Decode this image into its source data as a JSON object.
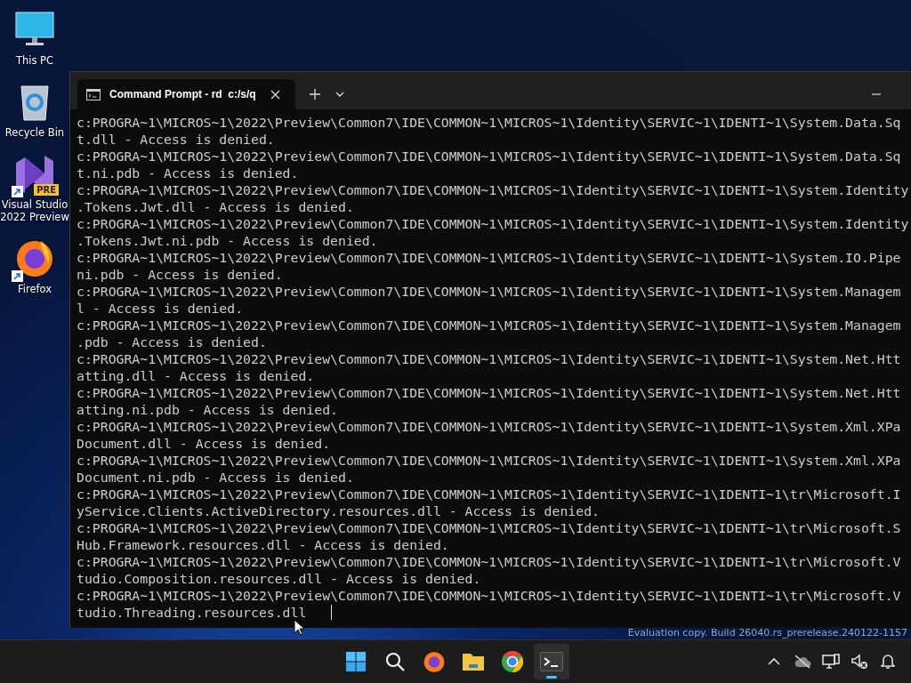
{
  "desktop_icons": [
    {
      "label": "This PC",
      "kind": "pc",
      "shortcut": false
    },
    {
      "label": "Recycle Bin",
      "kind": "bin",
      "shortcut": false
    },
    {
      "label": "Visual Studio 2022 Preview",
      "kind": "vs",
      "badge": "PRE",
      "shortcut": true
    },
    {
      "label": "Firefox",
      "kind": "firefox",
      "shortcut": true
    }
  ],
  "window": {
    "tabs": [
      {
        "title": "Command Prompt - rd  c:/s/q",
        "selected": true
      }
    ],
    "lines": [
      "c:PROGRA~1\\MICROS~1\\2022\\Preview\\Common7\\IDE\\COMMON~1\\MICROS~1\\Identity\\SERVIC~1\\IDENTI~1\\System.Data.Sq",
      "t.dll - Access is denied.",
      "c:PROGRA~1\\MICROS~1\\2022\\Preview\\Common7\\IDE\\COMMON~1\\MICROS~1\\Identity\\SERVIC~1\\IDENTI~1\\System.Data.Sq",
      "t.ni.pdb - Access is denied.",
      "c:PROGRA~1\\MICROS~1\\2022\\Preview\\Common7\\IDE\\COMMON~1\\MICROS~1\\Identity\\SERVIC~1\\IDENTI~1\\System.Identity",
      ".Tokens.Jwt.dll - Access is denied.",
      "c:PROGRA~1\\MICROS~1\\2022\\Preview\\Common7\\IDE\\COMMON~1\\MICROS~1\\Identity\\SERVIC~1\\IDENTI~1\\System.Identity",
      ".Tokens.Jwt.ni.pdb - Access is denied.",
      "c:PROGRA~1\\MICROS~1\\2022\\Preview\\Common7\\IDE\\COMMON~1\\MICROS~1\\Identity\\SERVIC~1\\IDENTI~1\\System.IO.Pipe",
      "ni.pdb - Access is denied.",
      "c:PROGRA~1\\MICROS~1\\2022\\Preview\\Common7\\IDE\\COMMON~1\\MICROS~1\\Identity\\SERVIC~1\\IDENTI~1\\System.Managem",
      "l - Access is denied.",
      "c:PROGRA~1\\MICROS~1\\2022\\Preview\\Common7\\IDE\\COMMON~1\\MICROS~1\\Identity\\SERVIC~1\\IDENTI~1\\System.Managem",
      ".pdb - Access is denied.",
      "c:PROGRA~1\\MICROS~1\\2022\\Preview\\Common7\\IDE\\COMMON~1\\MICROS~1\\Identity\\SERVIC~1\\IDENTI~1\\System.Net.Htt",
      "atting.dll - Access is denied.",
      "c:PROGRA~1\\MICROS~1\\2022\\Preview\\Common7\\IDE\\COMMON~1\\MICROS~1\\Identity\\SERVIC~1\\IDENTI~1\\System.Net.Htt",
      "atting.ni.pdb - Access is denied.",
      "c:PROGRA~1\\MICROS~1\\2022\\Preview\\Common7\\IDE\\COMMON~1\\MICROS~1\\Identity\\SERVIC~1\\IDENTI~1\\System.Xml.XPa",
      "Document.dll - Access is denied.",
      "c:PROGRA~1\\MICROS~1\\2022\\Preview\\Common7\\IDE\\COMMON~1\\MICROS~1\\Identity\\SERVIC~1\\IDENTI~1\\System.Xml.XPa",
      "Document.ni.pdb - Access is denied.",
      "c:PROGRA~1\\MICROS~1\\2022\\Preview\\Common7\\IDE\\COMMON~1\\MICROS~1\\Identity\\SERVIC~1\\IDENTI~1\\tr\\Microsoft.I",
      "yService.Clients.ActiveDirectory.resources.dll - Access is denied.",
      "c:PROGRA~1\\MICROS~1\\2022\\Preview\\Common7\\IDE\\COMMON~1\\MICROS~1\\Identity\\SERVIC~1\\IDENTI~1\\tr\\Microsoft.S",
      "Hub.Framework.resources.dll - Access is denied.",
      "c:PROGRA~1\\MICROS~1\\2022\\Preview\\Common7\\IDE\\COMMON~1\\MICROS~1\\Identity\\SERVIC~1\\IDENTI~1\\tr\\Microsoft.V",
      "tudio.Composition.resources.dll - Access is denied.",
      "c:PROGRA~1\\MICROS~1\\2022\\Preview\\Common7\\IDE\\COMMON~1\\MICROS~1\\Identity\\SERVIC~1\\IDENTI~1\\tr\\Microsoft.V",
      "tudio.Threading.resources.dll"
    ]
  },
  "watermark": "Evaluation copy. Build 26040.rs_prerelease.240122-1157",
  "taskbar": {
    "apps": [
      {
        "kind": "start",
        "active": false
      },
      {
        "kind": "search",
        "active": false
      },
      {
        "kind": "firefox",
        "active": false
      },
      {
        "kind": "explorer",
        "active": false
      },
      {
        "kind": "chrome",
        "active": false
      },
      {
        "kind": "terminal",
        "active": true
      }
    ],
    "tray": [
      {
        "kind": "chevron"
      },
      {
        "kind": "cloud-off"
      },
      {
        "kind": "network"
      },
      {
        "kind": "volume-muted"
      },
      {
        "kind": "bell"
      }
    ]
  }
}
